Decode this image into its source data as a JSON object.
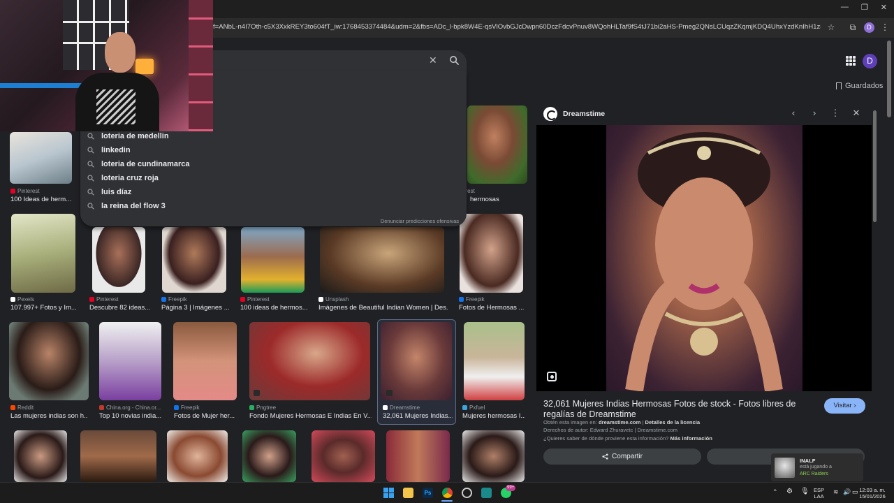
{
  "browser": {
    "url": "f=ANbL-n4I7Oth-c5X3XxkREY3to604fT_iw:1768453374484&udm=2&fbs=ADc_l-bpk8W4E-qsVlOvbGJcDwpn60DczFdcvPnuv8WQohHLTaf9fS4tJ71bi2aHS-Pmeg2QNsLCUqzZKqmjKDQ4UhxYzdKnIhH1z86lwDU-SKXvzfCtTBjuM3...",
    "profile_initial": "D",
    "window_controls": {
      "minimize": "—",
      "maximize": "❐",
      "close": "✕"
    }
  },
  "google": {
    "avatar_initial": "D",
    "saved_label": "Guardados",
    "search": {
      "clear": "✕"
    },
    "suggestions": [
      "loteria de medellin",
      "linkedin",
      "loteria de cundinamarca",
      "loteria cruz roja",
      "luis díaz",
      "la reina del flow 3"
    ],
    "report_link": "Denunciar predicciones ofensivas"
  },
  "results": {
    "row1": [
      {
        "source": "Pinterest",
        "caption": "100 Ideas de herm...",
        "fav": "#e60023"
      },
      {
        "source": "erest",
        "caption": "hermosas",
        "fav": "#e60023"
      }
    ],
    "row2": [
      {
        "source": "Pexels",
        "caption": "107.997+ Fotos y Im...",
        "fav": "#ffffff"
      },
      {
        "source": "Pinterest",
        "caption": "Descubre 82 ideas...",
        "fav": "#e60023"
      },
      {
        "source": "Freepik",
        "caption": "Página 3 | Imágenes ...",
        "fav": "#1273eb"
      },
      {
        "source": "Pinterest",
        "caption": "100 ideas de hermos...",
        "fav": "#e60023"
      },
      {
        "source": "Unsplash",
        "caption": "Imágenes de Beautiful Indian Women | Des...",
        "fav": "#ffffff"
      },
      {
        "source": "Freepik",
        "caption": "Fotos de Hermosas ...",
        "fav": "#1273eb"
      }
    ],
    "row3": [
      {
        "source": "Reddit",
        "caption": "Las mujeres indias son h...",
        "fav": "#ff4500"
      },
      {
        "source": "China.org - China.or...",
        "caption": "Top 10 novias india...",
        "fav": "#c0392b"
      },
      {
        "source": "Freepik",
        "caption": "Fotos de Mujer her...",
        "fav": "#1273eb"
      },
      {
        "source": "Pngtree",
        "caption": "Fondo Mujeres Hermosas E Indias En V...",
        "fav": "#27ae60"
      },
      {
        "source": "Dreamstime",
        "caption": "32,061 Mujeres Indias...",
        "fav": "#ffffff"
      },
      {
        "source": "Pxfuel",
        "caption": "Mujeres hermosas I...",
        "fav": "#3aa6e0"
      }
    ]
  },
  "panel": {
    "source": "Dreamstime",
    "title": "32,061 Mujeres Indias Hermosas Fotos de stock - Fotos libres de regalías de Dreamstime",
    "visit_label": "Visitar ›",
    "obtained_label": "Obtén esta imagen en:",
    "obtained_site": "dreamstime.com",
    "license_link": "Detalles de la licencia",
    "copyright": "Derechos de autor: Edward Zhuravetc | Dreamstime.com",
    "question": "¿Quieres saber de dónde proviene esta información?",
    "more_info": "Más información",
    "share_label": "Compartir"
  },
  "taskbar": {
    "language": "ESP",
    "language_sub": "LAA",
    "time": "12:03 a. m.",
    "date": "15/01/2026",
    "whatsapp_badge": "99+"
  },
  "notification": {
    "name": "INALF",
    "status": "está jugando a",
    "game": "ARC Raiders"
  }
}
